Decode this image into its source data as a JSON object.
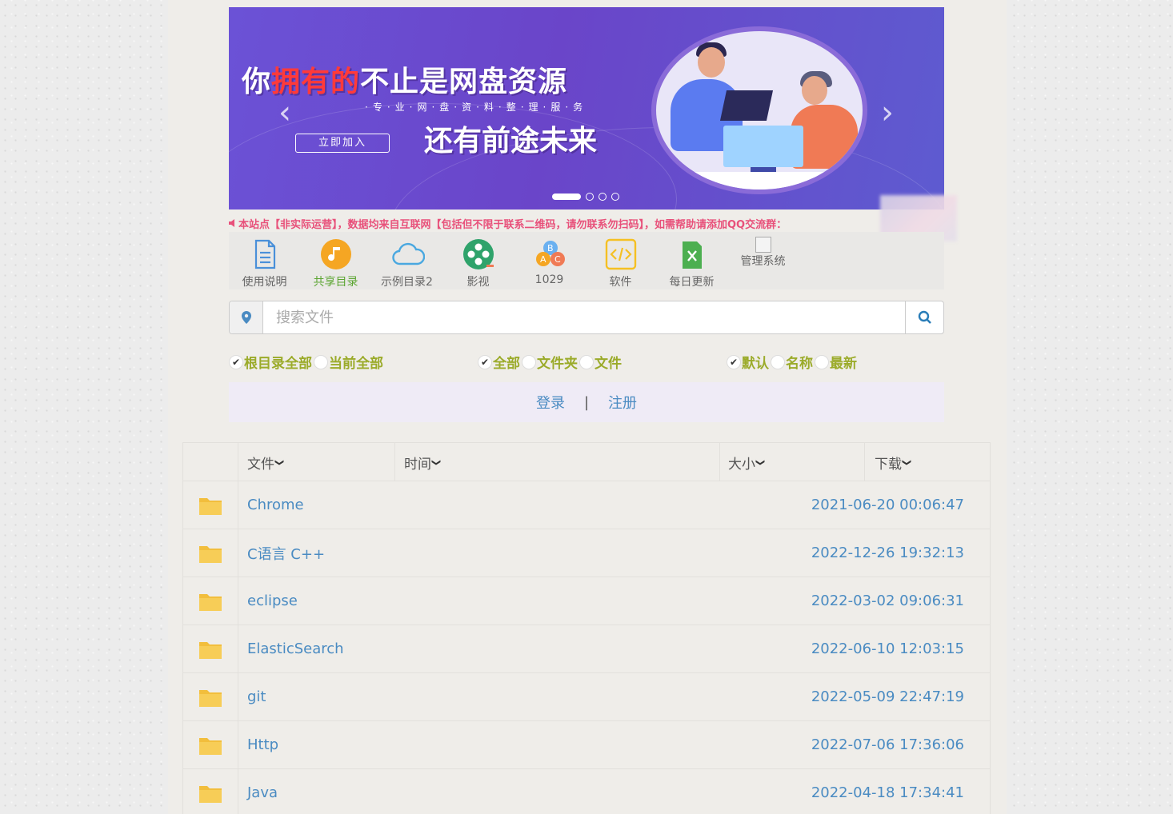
{
  "banner": {
    "title_line1_pre": "你",
    "title_line1_highlight": "拥有的",
    "title_line1_post": "不止是网盘资源",
    "subtitle": "·专·业·网·盘·资·料·整·理·服·务",
    "title_line2": "还有前途未来",
    "join_button": "立即加入",
    "prev_arrow": "‹",
    "next_arrow": "›",
    "slide_count": 4,
    "active_slide": 1
  },
  "notice": {
    "text": "本站点【非实际运营】，数据均来自互联网【包括但不限于联系二维码，请勿联系勿扫码】，如需帮助请添加QQ交流群："
  },
  "nav": {
    "items": [
      {
        "label": "使用说明",
        "icon": "document-icon",
        "color": "#4a90d9"
      },
      {
        "label": "共享目录",
        "icon": "music-note-icon",
        "color": "#f5a623",
        "active": true
      },
      {
        "label": "示例目录2",
        "icon": "cloud-icon",
        "color": "#4aa8e0"
      },
      {
        "label": "影视",
        "icon": "film-reel-icon",
        "color": "#2fa36b"
      },
      {
        "label": "1029",
        "icon": "abc-blocks-icon",
        "color": "#f07a55"
      },
      {
        "label": "软件",
        "icon": "code-icon",
        "color": "#f5c023"
      },
      {
        "label": "每日更新",
        "icon": "excel-file-icon",
        "color": "#4caf50"
      },
      {
        "label": "管理系统",
        "icon": "broken-image-icon",
        "color": "#999999"
      }
    ]
  },
  "search": {
    "placeholder": "搜索文件",
    "value": ""
  },
  "filters": {
    "scope": [
      {
        "label": "根目录全部",
        "checked": true
      },
      {
        "label": "当前全部",
        "checked": false
      }
    ],
    "type": [
      {
        "label": "全部",
        "checked": true
      },
      {
        "label": "文件夹",
        "checked": false
      },
      {
        "label": "文件",
        "checked": false
      }
    ],
    "sort": [
      {
        "label": "默认",
        "checked": true
      },
      {
        "label": "名称",
        "checked": false
      },
      {
        "label": "最新",
        "checked": false
      }
    ]
  },
  "auth": {
    "login": "登录",
    "separator": "|",
    "register": "注册"
  },
  "table": {
    "headers": {
      "file": "文件",
      "time": "时间",
      "size": "大小",
      "download": "下载"
    },
    "rows": [
      {
        "name": "Chrome",
        "time": "2021-06-20 00:06:47"
      },
      {
        "name": "C语言 C++",
        "time": "2022-12-26 19:32:13"
      },
      {
        "name": "eclipse",
        "time": "2022-03-02 09:06:31"
      },
      {
        "name": "ElasticSearch",
        "time": "2022-06-10 12:03:15"
      },
      {
        "name": "git",
        "time": "2022-05-09 22:47:19"
      },
      {
        "name": "Http",
        "time": "2022-07-06 17:36:06"
      },
      {
        "name": "Java",
        "time": "2022-04-18 17:34:41"
      }
    ]
  },
  "colors": {
    "link": "#4a8bc2",
    "filter": "#9bab2a",
    "notice": "#e8507a",
    "folder": "#f7cd57"
  }
}
